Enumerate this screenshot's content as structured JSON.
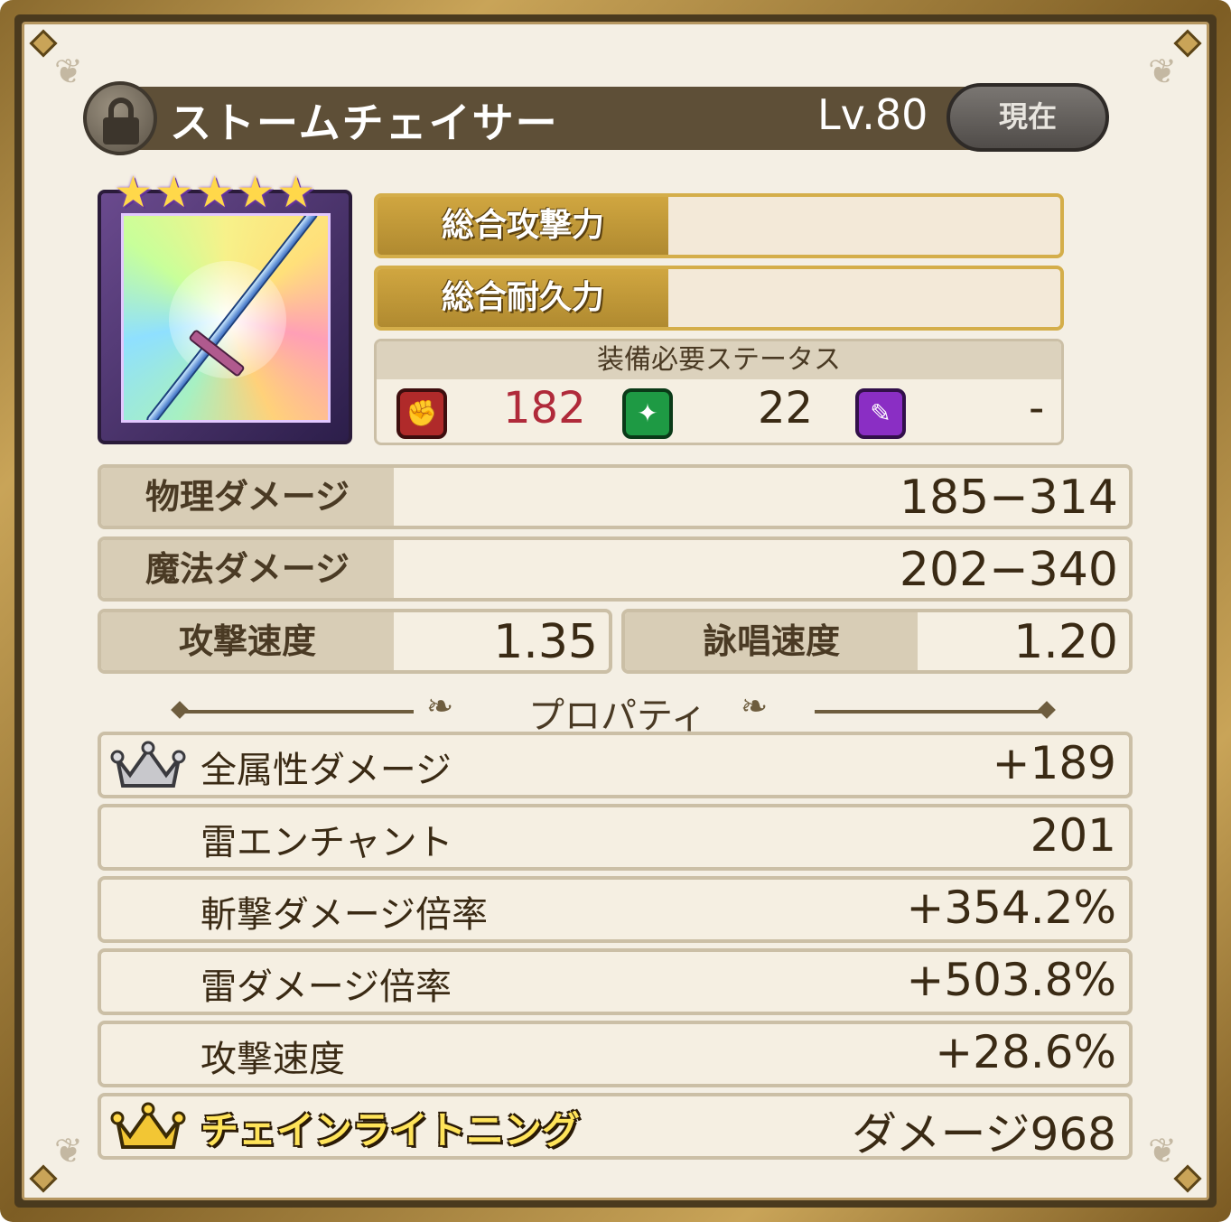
{
  "item": {
    "name": "ストームチェイサー",
    "level": "Lv.80",
    "current_label": "現在",
    "rarity_stars": 5
  },
  "power": {
    "attack_label": "総合攻撃力",
    "attack_value": "",
    "durability_label": "総合耐久力",
    "durability_value": ""
  },
  "requirements": {
    "title": "装備必要ステータス",
    "strength": "182",
    "dexterity": "22",
    "intelligence": "-"
  },
  "stats": {
    "physical_label": "物理ダメージ",
    "physical_value": "185−314",
    "magic_label": "魔法ダメージ",
    "magic_value": "202−340",
    "attack_speed_label": "攻撃速度",
    "attack_speed_value": "1.35",
    "cast_speed_label": "詠唱速度",
    "cast_speed_value": "1.20"
  },
  "properties": {
    "title": "プロパティ",
    "items": [
      {
        "name": "全属性ダメージ",
        "value": "+189"
      },
      {
        "name": "雷エンチャント",
        "value": "201"
      },
      {
        "name": "斬撃ダメージ倍率",
        "value": "+354.2%"
      },
      {
        "name": "雷ダメージ倍率",
        "value": "+503.8%"
      },
      {
        "name": "攻撃速度",
        "value": "+28.6%"
      }
    ],
    "skill": {
      "name": "チェインライトニング",
      "value": "ダメージ968"
    }
  },
  "colors": {
    "gold": "#d4ae4a",
    "title_bar": "#5e4f37",
    "strength_value": "#b02a3a",
    "text_dark": "#3a2a14"
  },
  "icons": {
    "lock": "lock-icon",
    "strength": "fist-icon",
    "dexterity": "sparkle-icon",
    "intelligence": "wand-icon",
    "silver_crown": "silver-crown-icon",
    "gold_crown": "gold-crown-icon"
  }
}
